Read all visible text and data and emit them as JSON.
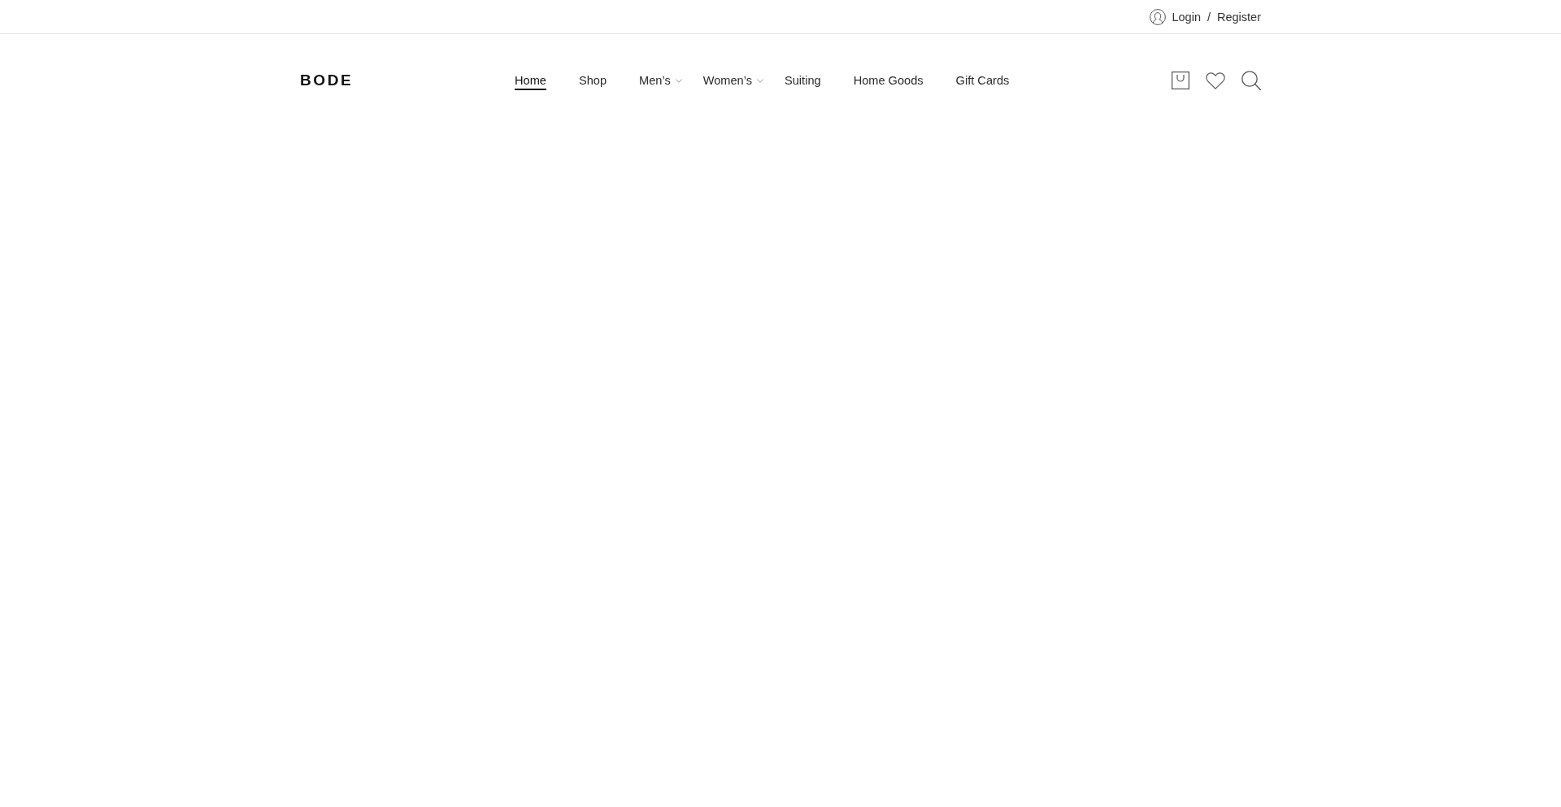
{
  "top_bar": {
    "account": {
      "login": "Login",
      "separator": "/",
      "register": "Register"
    }
  },
  "header": {
    "logo": "BODE",
    "nav": [
      {
        "label": "Home",
        "selected": true,
        "has_submenu": false
      },
      {
        "label": "Shop",
        "selected": false,
        "has_submenu": false
      },
      {
        "label": "Men’s",
        "selected": false,
        "has_submenu": true
      },
      {
        "label": "Women’s",
        "selected": false,
        "has_submenu": true
      },
      {
        "label": "Suiting",
        "selected": false,
        "has_submenu": false
      },
      {
        "label": "Home Goods",
        "selected": false,
        "has_submenu": false
      },
      {
        "label": "Gift Cards",
        "selected": false,
        "has_submenu": false
      }
    ]
  }
}
